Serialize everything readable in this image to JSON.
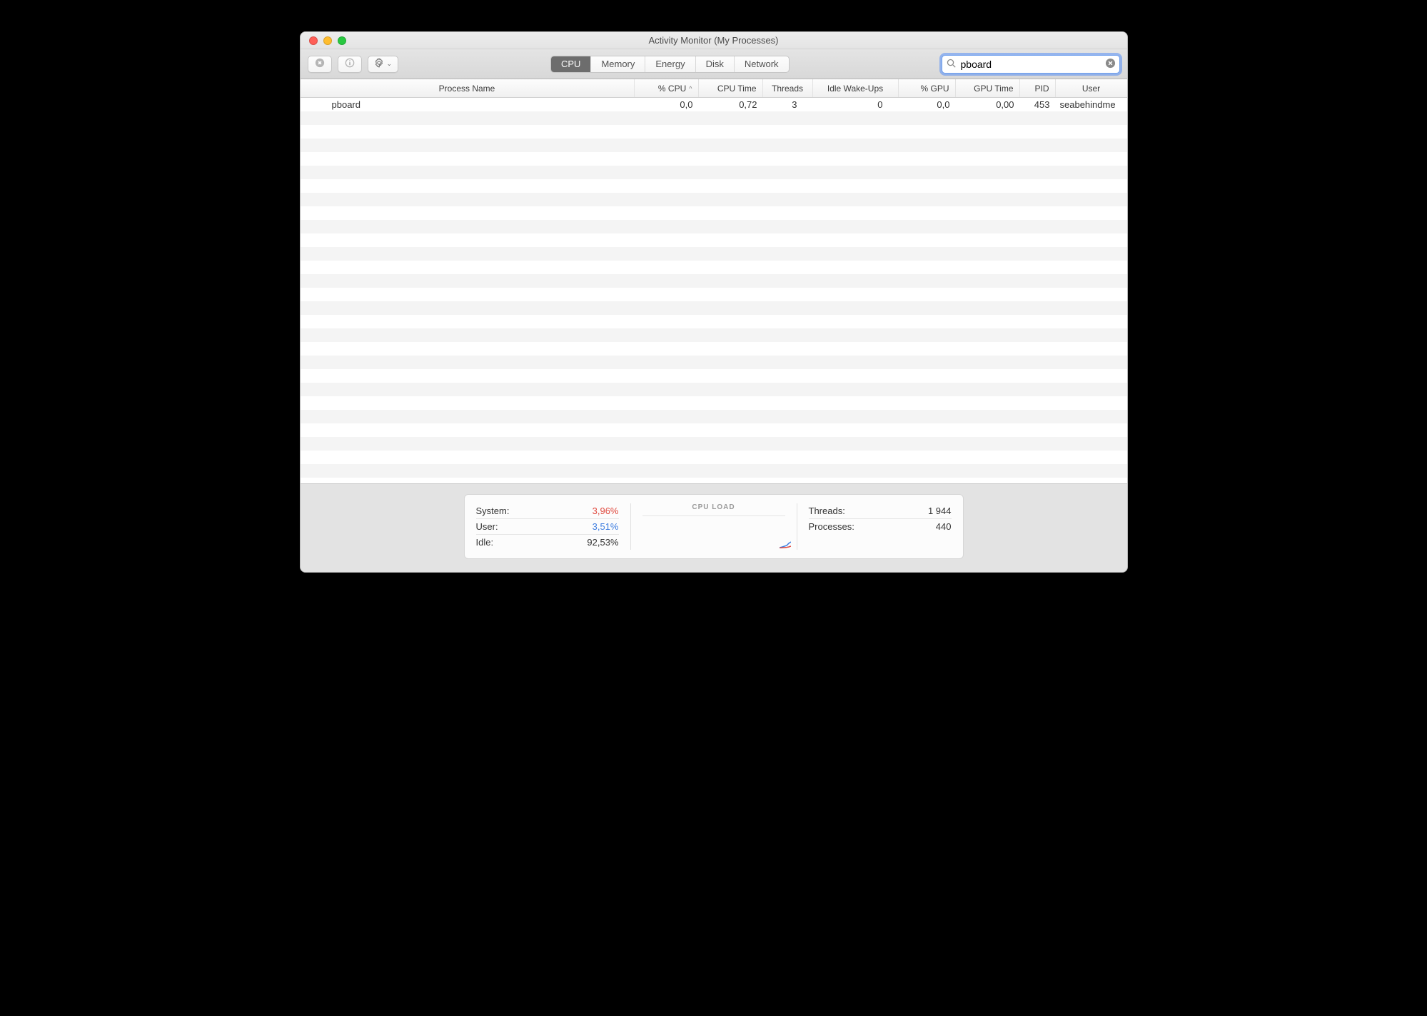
{
  "window": {
    "title": "Activity Monitor (My Processes)"
  },
  "toolbar": {
    "tabs": [
      "CPU",
      "Memory",
      "Energy",
      "Disk",
      "Network"
    ],
    "active_tab": "CPU",
    "search_value": "pboard"
  },
  "columns": {
    "name": "Process Name",
    "cpu": "% CPU",
    "cputime": "CPU Time",
    "threads": "Threads",
    "wake": "Idle Wake-Ups",
    "gpu": "% GPU",
    "gputime": "GPU Time",
    "pid": "PID",
    "user": "User"
  },
  "sort_indicator": "^",
  "rows": [
    {
      "name": "pboard",
      "cpu": "0,0",
      "cputime": "0,72",
      "threads": "3",
      "wake": "0",
      "gpu": "0,0",
      "gputime": "0,00",
      "pid": "453",
      "user": "seabehindme"
    }
  ],
  "footer": {
    "left": {
      "system_label": "System:",
      "system_value": "3,96%",
      "user_label": "User:",
      "user_value": "3,51%",
      "idle_label": "Idle:",
      "idle_value": "92,53%"
    },
    "mid_label": "CPU LOAD",
    "right": {
      "threads_label": "Threads:",
      "threads_value": "1 944",
      "processes_label": "Processes:",
      "processes_value": "440"
    }
  }
}
